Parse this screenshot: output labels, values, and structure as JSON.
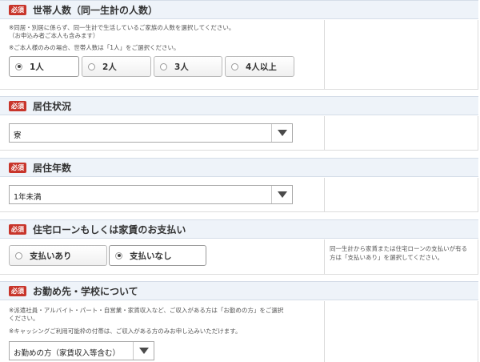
{
  "sections": {
    "household": {
      "badge": "必須",
      "title": "世帯人数（同一生計の人数）",
      "notes": [
        "※同居・別居に係らず、同一生計で生活しているご家族の人数を選択してください。",
        "（お申込み者ご本人も含みます）",
        "※ご本人様のみの場合、世帯人数は「1人」をご選択ください。"
      ],
      "options": [
        "1人",
        "2人",
        "3人",
        "4人以上"
      ],
      "selected": "1人"
    },
    "residence": {
      "badge": "必須",
      "title": "居住状況",
      "value": "寮"
    },
    "years": {
      "badge": "必須",
      "title": "居住年数",
      "value": "1年未満"
    },
    "loan": {
      "badge": "必須",
      "title": "住宅ローンもしくは家賃のお支払い",
      "options": [
        "支払いあり",
        "支払いなし"
      ],
      "selected": "支払いなし",
      "help": [
        "同一生計から家賃または住宅ローンの支払いが有る",
        "方は「支払いあり」を選択してください。"
      ]
    },
    "work": {
      "badge": "必須",
      "title": "お勤め先・学校について",
      "notes": [
        "※派遣社員・アルバイト・パート・自営業・家賃収入など、ご収入がある方は「お勤めの方」をご選択",
        "ください。",
        "※キャッシングご利用可能枠の付帯は、ご収入がある方のみお申し込みいただけます。"
      ],
      "value": "お勤めの方（家賃収入等含む）"
    }
  }
}
